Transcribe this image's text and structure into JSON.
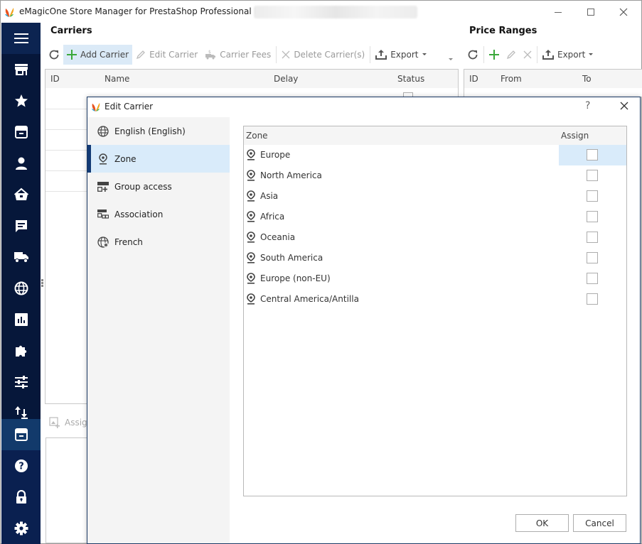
{
  "window": {
    "title": "eMagicOne Store Manager for PrestaShop Professional Edition",
    "controls": {
      "minimize": "minimize",
      "maximize": "maximize",
      "close": "close"
    }
  },
  "sidebar": {
    "items": [
      {
        "icon": "hamburger-menu-icon",
        "label": "Menu"
      },
      {
        "icon": "store-icon",
        "label": "Store"
      },
      {
        "icon": "star-icon",
        "label": "Favorites"
      },
      {
        "icon": "inbox-icon",
        "label": "Catalog"
      },
      {
        "icon": "user-icon",
        "label": "Customers"
      },
      {
        "icon": "basket-icon",
        "label": "Orders"
      },
      {
        "icon": "message-icon",
        "label": "Messages"
      },
      {
        "icon": "truck-icon",
        "label": "Shipping"
      },
      {
        "icon": "globe-icon",
        "label": "Localization"
      },
      {
        "icon": "chart-icon",
        "label": "Reports"
      },
      {
        "icon": "puzzle-icon",
        "label": "Addons"
      },
      {
        "icon": "sliders-icon",
        "label": "Settings"
      },
      {
        "icon": "import-export-icon",
        "label": "Import/Export"
      },
      {
        "icon": "archive-icon",
        "label": "Archive",
        "active": true
      },
      {
        "icon": "help-icon",
        "label": "Help"
      },
      {
        "icon": "lock-icon",
        "label": "Security"
      },
      {
        "icon": "gear-icon",
        "label": "Preferences"
      }
    ]
  },
  "carriers": {
    "title": "Carriers",
    "toolbar": {
      "refresh": "Refresh",
      "add": "Add Carrier",
      "edit": "Edit Carrier",
      "fees": "Carrier Fees",
      "delete": "Delete Carrier(s)",
      "export": "Export"
    },
    "columns": [
      "ID",
      "Name",
      "Delay",
      "Status"
    ],
    "assign_label": "Assign"
  },
  "price_ranges": {
    "title": "Price Ranges",
    "toolbar": {
      "export": "Export"
    },
    "columns": [
      "ID",
      "From",
      "To"
    ]
  },
  "dialog": {
    "title": "Edit Carrier",
    "help": "?",
    "nav": [
      {
        "icon": "globe-icon",
        "label": "English (English)"
      },
      {
        "icon": "map-pin-icon",
        "label": "Zone",
        "active": true
      },
      {
        "icon": "group-access-icon",
        "label": "Group access"
      },
      {
        "icon": "association-icon",
        "label": "Association"
      },
      {
        "icon": "globe-language-icon",
        "label": "French"
      }
    ],
    "zone_grid": {
      "columns": [
        "Zone",
        "Assign"
      ],
      "rows": [
        {
          "zone": "Europe",
          "assigned": false,
          "selected": true
        },
        {
          "zone": "North America",
          "assigned": false
        },
        {
          "zone": "Asia",
          "assigned": false
        },
        {
          "zone": "Africa",
          "assigned": false
        },
        {
          "zone": "Oceania",
          "assigned": false
        },
        {
          "zone": "South America",
          "assigned": false
        },
        {
          "zone": "Europe (non-EU)",
          "assigned": false
        },
        {
          "zone": "Central America/Antilla",
          "assigned": false
        }
      ]
    },
    "buttons": {
      "ok": "OK",
      "cancel": "Cancel"
    }
  },
  "colors": {
    "sidebar_bg": "#06173a",
    "sidebar_active": "#123a6b",
    "selection": "#d9ebfa",
    "accent_green": "#3aa83a",
    "dialog_border": "#1b3a66"
  }
}
